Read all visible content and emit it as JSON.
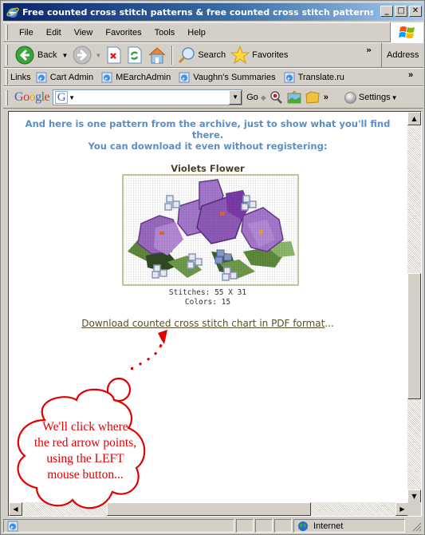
{
  "window": {
    "title": "Free counted cross stitch patterns & free counted cross stitch patterns for Br...",
    "buttons": {
      "minimize": "_",
      "maximize": "□",
      "close": "✕"
    }
  },
  "menu": {
    "items": [
      "File",
      "Edit",
      "View",
      "Favorites",
      "Tools",
      "Help"
    ]
  },
  "toolbar": {
    "back_label": "Back",
    "search_label": "Search",
    "favorites_label": "Favorites",
    "overflow": "»",
    "address_label": "Address"
  },
  "links": {
    "label": "Links",
    "items": [
      "Cart Admin",
      "MEarchAdmin",
      "Vaughn's Summaries",
      "Translate.ru"
    ],
    "overflow": "»"
  },
  "googlebar": {
    "logo": "Google",
    "search_value": "",
    "go_label": "Go",
    "overflow": "»",
    "settings_label": "Settings"
  },
  "page": {
    "intro_line1": "And here is one pattern from the archive, just to show what you'll find there.",
    "intro_line2": "You can download it even without registering:",
    "pattern_title": "Violets Flower",
    "stitches": "Stitches: 55 X 31",
    "colors": "Colors: 15",
    "download_link": "Download counted cross stitch chart in PDF format",
    "download_suffix": "..."
  },
  "annotation": {
    "line1": "We'll click where",
    "line2": "the red arrow points,",
    "line3": "using the LEFT",
    "line4": "mouse button...",
    "color": "#e00000"
  },
  "scroll": {
    "vertical_position": 0.62,
    "horizontal_position": 0.5
  },
  "status": {
    "text": "",
    "zone": "Internet"
  },
  "colors": {
    "intro_text": "#5a8fc6",
    "title_text": "#4a3f28",
    "link_text": "#5a4d2a",
    "frame_border": "#c5c49b"
  }
}
